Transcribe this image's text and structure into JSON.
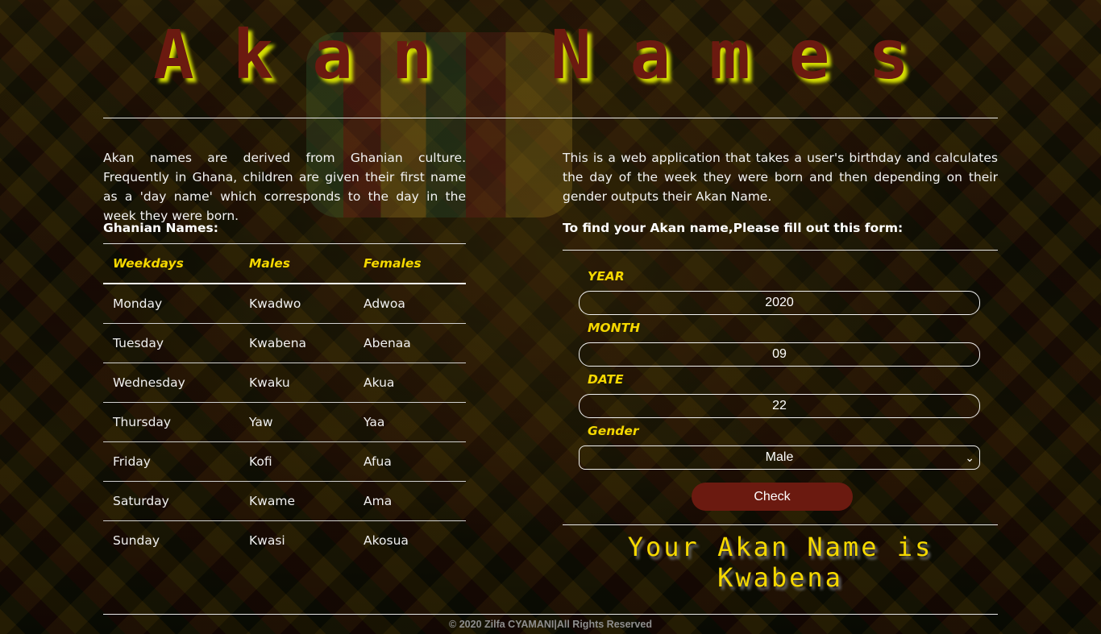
{
  "header": {
    "title": "Akan Names"
  },
  "left": {
    "intro": "Akan names are derived from Ghanian culture. Frequently in Ghana, children are given their first name as a 'day name' which corresponds to the day in the week they were born.",
    "subtitle": "Ghanian Names:",
    "table": {
      "headers": [
        "Weekdays",
        "Males",
        "Females"
      ],
      "rows": [
        [
          "Monday",
          "Kwadwo",
          "Adwoa"
        ],
        [
          "Tuesday",
          "Kwabena",
          "Abenaa"
        ],
        [
          "Wednesday",
          "Kwaku",
          "Akua"
        ],
        [
          "Thursday",
          "Yaw",
          "Yaa"
        ],
        [
          "Friday",
          "Kofi",
          "Afua"
        ],
        [
          "Saturday",
          "Kwame",
          "Ama"
        ],
        [
          "Sunday",
          "Kwasi",
          "Akosua"
        ]
      ]
    }
  },
  "right": {
    "intro": "This is a web application that takes a user's birthday and calculates the day of the week they were born and then depending on their gender outputs their Akan Name.",
    "subtitle": "To find your Akan name,Please fill out this form:",
    "form": {
      "year_label": "YEAR",
      "year_value": "2020",
      "month_label": "MONTH",
      "month_value": "09",
      "date_label": "DATE",
      "date_value": "22",
      "gender_label": "Gender",
      "gender_value": "Male",
      "check_label": "Check"
    },
    "result": "Your Akan Name is Kwabena"
  },
  "footer": {
    "text": "© 2020 Zilfa CYAMANI|All Rights Reserved"
  },
  "colors": {
    "accent": "#f5d800",
    "brand": "#6b1a10"
  },
  "icons": {
    "select_arrow": "chevron-down-icon"
  }
}
